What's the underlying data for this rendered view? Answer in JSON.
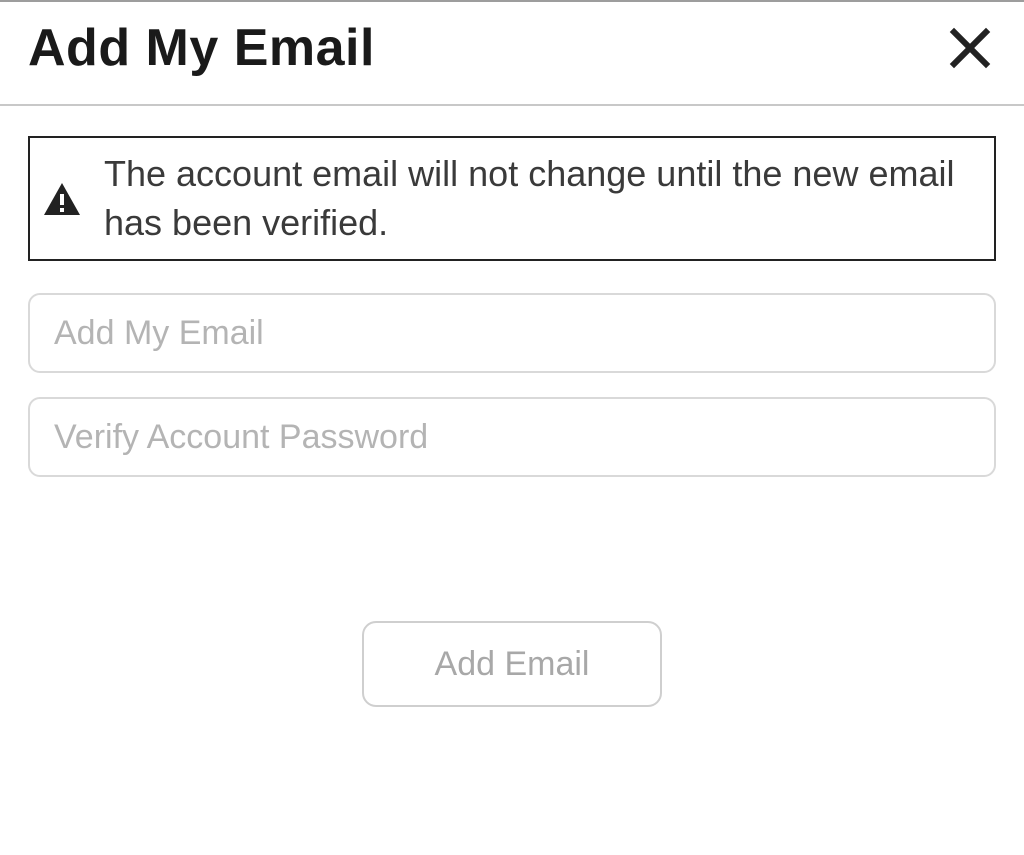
{
  "dialog": {
    "title": "Add My Email",
    "warning": {
      "message": "The account email will not change until the new email has been verified."
    },
    "fields": {
      "email": {
        "placeholder": "Add My Email",
        "value": ""
      },
      "password": {
        "placeholder": "Verify Account Password",
        "value": ""
      }
    },
    "actions": {
      "submit_label": "Add Email"
    }
  }
}
